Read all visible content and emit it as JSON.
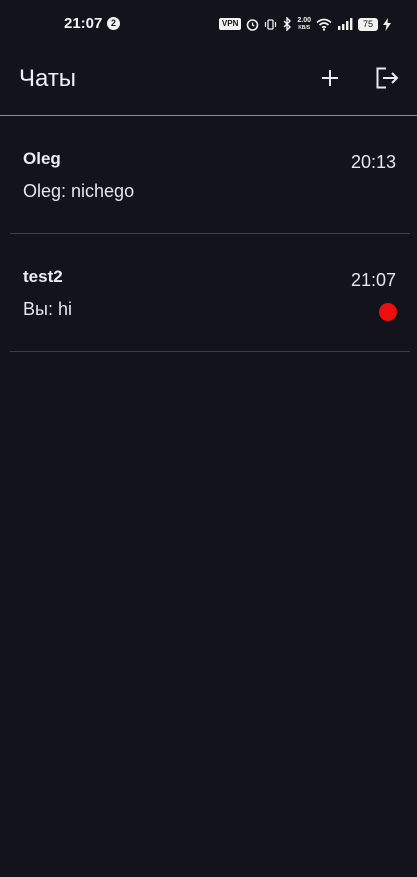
{
  "status_bar": {
    "time": "21:07",
    "notification_count": "2",
    "vpn": "VPN",
    "net_speed_value": "2.00",
    "net_speed_unit": "KB/S",
    "battery": "75"
  },
  "app_bar": {
    "title": "Чаты",
    "add_icon": "plus-icon",
    "logout_icon": "logout-icon"
  },
  "chats": [
    {
      "name": "Oleg",
      "time": "20:13",
      "last_message": "Oleg: nichego",
      "unread": false
    },
    {
      "name": "test2",
      "time": "21:07",
      "last_message": "Вы: hi",
      "unread": true
    }
  ],
  "colors": {
    "background": "#12131b",
    "unread_dot": "#ee0e0e",
    "divider": "#3d3e46"
  }
}
